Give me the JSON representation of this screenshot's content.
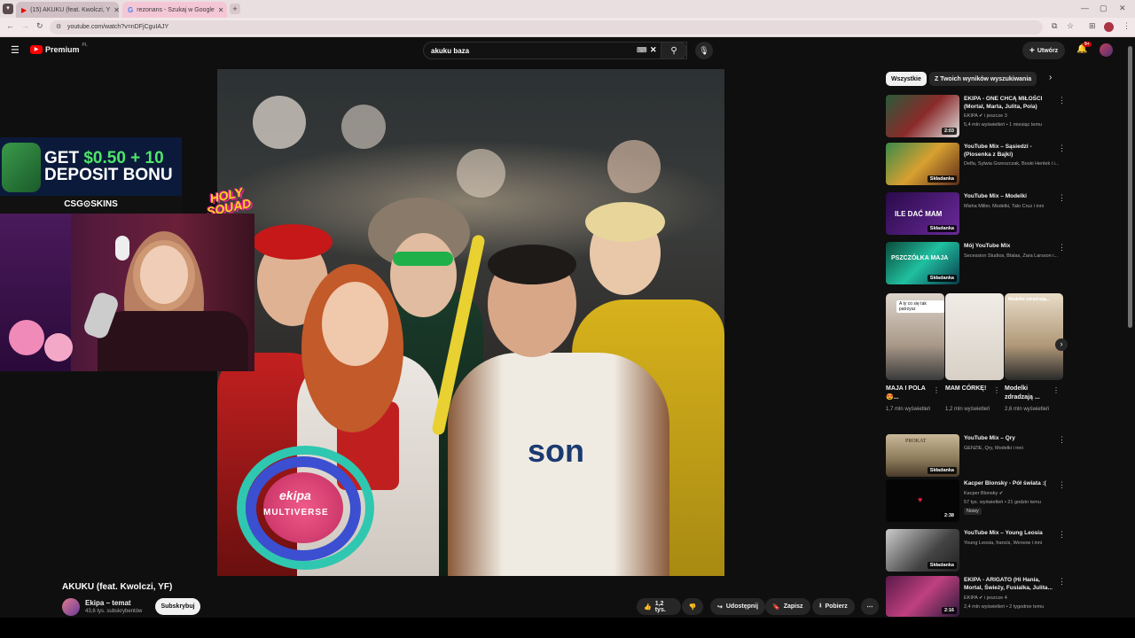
{
  "browser": {
    "tabs": [
      {
        "label": "(15) AKUKU (feat. Kwolczi, Y",
        "active": true
      },
      {
        "label": "rezonans - Szukaj w Google",
        "active": false
      }
    ],
    "url": "youtube.com/watch?v=nDFjCguIAJY"
  },
  "header": {
    "logo_label": "Premium",
    "logo_sup": "PL",
    "search_query": "akuku baza",
    "create_label": "Utwórz",
    "notifications": "9+"
  },
  "video": {
    "title": "AKUKU (feat. Kwolczi, YF)",
    "channel_name": "Ekipa – temat",
    "channel_subs": "43,6 tys. subskrybentów",
    "subscribe_label": "Subskrybuj",
    "likes": "1,2 tys.",
    "share_label": "Udostępnij",
    "save_label": "Zapisz",
    "download_label": "Pobierz",
    "watermark_top": "ekipa",
    "watermark_bottom": "MULTIVERSE"
  },
  "overlay": {
    "ad_line1_white": "GET ",
    "ad_line1_green": "$0.50 + 10",
    "ad_line2": "DEPOSIT BONU",
    "ad_brand": "CSG⊙SKINS",
    "sticker": "HOLY SQUAD"
  },
  "filters": {
    "chip_all": "Wszystkie",
    "chip_results": "Z Twoich wyników wyszukiwania"
  },
  "recommendations": [
    {
      "title": "EKIPA - ONE CHCĄ MIŁOŚCI (Mortal, Marta, Julita, Pola)",
      "meta1": "EKIPA ✔ i jeszcze 3",
      "meta2": "5,4 mln wyświetleń • 1 miesiąc temu",
      "badge": "2:03",
      "color": "#8a2a2a"
    },
    {
      "title": "YouTube Mix – Sąsiedzi - (Piosenka z Bajki)",
      "meta1": "Delfa, Sylwia Grzeszczak, Boski Henlek i i...",
      "badge": "Składanka",
      "color": "#2a6a4a"
    },
    {
      "title": "YouTube Mix – Modelki",
      "meta1": "Misha Miller, Modelki, Talo Cruz i inni",
      "badge": "Składanka",
      "color": "#4a1a6a",
      "thumbtext": "ILE DAĆ MAM"
    },
    {
      "title": "Mój YouTube Mix",
      "meta1": "Secession Studios, Blalas, Zara Larsson i...",
      "badge": "Składanka",
      "color": "#0a6a5a",
      "thumbtext": "PSZCZÓŁKA MAJA"
    },
    {
      "title": "YouTube Mix – Qry",
      "meta1": "GENZIE, Qry, Modelki i inni",
      "badge": "Składanka",
      "color": "#8a7a5a",
      "thumbtext": "PROKAT"
    },
    {
      "title": "Kacper Blonsky - Pół świata :(",
      "meta1": "Kacper Blonsky ✔",
      "meta2": "57 tys. wyświetleń • 21 godzin temu",
      "new": "Nowy",
      "badge": "2:38",
      "color": "#050505"
    },
    {
      "title": "YouTube Mix – Young Leosia",
      "meta1": "Young Leosia, francis, Wersow i inni",
      "badge": "Składanka",
      "color": "#555"
    },
    {
      "title": "EKIPA - ARIGATO (Hi Hania, Mortal, Świeży, Fusialka, Julita...",
      "meta1": "EKIPA ✔ i jeszcze 4",
      "meta2": "2,4 mln wyświetleń • 2 tygodnie temu",
      "badge": "2:16",
      "color": "#7a2a5a"
    }
  ],
  "shorts": [
    {
      "title": "MAJA I POLA😍...",
      "views": "1,7 mln wyświetleń",
      "caption": "A ty co się tak patrzysz",
      "color": "#c9b8a8"
    },
    {
      "title": "MAM CÓRKĘ!",
      "views": "1,2 mln wyświetleń",
      "color": "#e6e0d8"
    },
    {
      "title": "Modelki zdradzają ...",
      "views": "2,6 mln wyświetleń",
      "caption": "Modelki zdradzają...",
      "color": "#d8c8b0"
    }
  ]
}
